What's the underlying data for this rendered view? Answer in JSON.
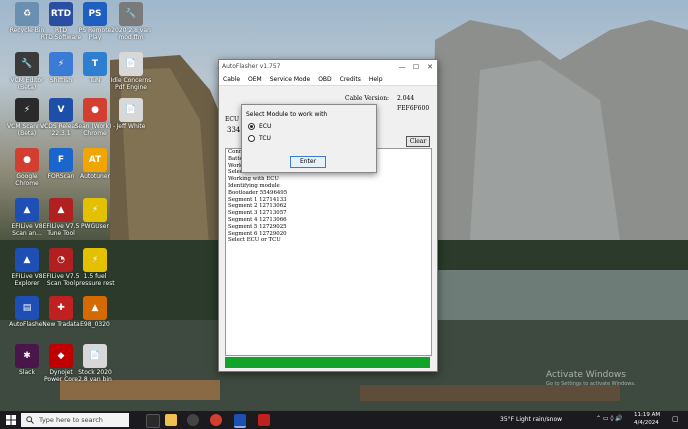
{
  "desktop": {
    "icons": [
      {
        "label": "Recycle Bin",
        "glyph": "♻",
        "color": "#6b8fb0"
      },
      {
        "label": "RTD\nRTD Software",
        "glyph": "RTD",
        "color": "#2a4fa0"
      },
      {
        "label": "PS Remote\nPlay",
        "glyph": "PS",
        "color": "#1f5fbf"
      },
      {
        "label": "2020 2.8 van\nmod ffm",
        "glyph": "🔧",
        "color": "#7a7a7a"
      },
      {
        "label": "VCM Editor\n(Beta)",
        "glyph": "🔧",
        "color": "#3a3a3a"
      },
      {
        "label": "Shiftish",
        "glyph": "⚡",
        "color": "#3a7bd5"
      },
      {
        "label": "TuN",
        "glyph": "T",
        "color": "#2f7fd0"
      },
      {
        "label": "Idle Concerns\nPdf Engine",
        "glyph": "📄",
        "color": "#d8d8d8"
      },
      {
        "label": "VCM Scanner\n(Beta)",
        "glyph": "⚡",
        "color": "#2a2a2a"
      },
      {
        "label": "VCDS Release\n22.3.1",
        "glyph": "V",
        "color": "#1e4fa8"
      },
      {
        "label": "Sean (Work) -\nChrome",
        "glyph": "●",
        "color": "#d23f31"
      },
      {
        "label": "Jeff White",
        "glyph": "📄",
        "color": "#d8d8d8"
      },
      {
        "label": "Google\nChrome",
        "glyph": "●",
        "color": "#d23f31"
      },
      {
        "label": "FORScan",
        "glyph": "F",
        "color": "#1a66cc"
      },
      {
        "label": "Autotuner",
        "glyph": "AT",
        "color": "#f0a500"
      },
      {
        "label": "EFILive V8\nScan an...",
        "glyph": "▲",
        "color": "#1d4fb5"
      },
      {
        "label": "EFILive V7.5\nTune Tool",
        "glyph": "▲",
        "color": "#b02020"
      },
      {
        "label": "PWGUser",
        "glyph": "⚡",
        "color": "#e3c100"
      },
      {
        "label": "EFILive V8\nExplorer",
        "glyph": "▲",
        "color": "#1d4fb5"
      },
      {
        "label": "EFILive V7.5\nScan Tool",
        "glyph": "◔",
        "color": "#b02020"
      },
      {
        "label": "1.5 fuel\npressure rest",
        "glyph": "⚡",
        "color": "#e3c100"
      },
      {
        "label": "AutoFlasher",
        "glyph": "▤",
        "color": "#1d4fb5"
      },
      {
        "label": "New Tradata",
        "glyph": "✚",
        "color": "#c02020"
      },
      {
        "label": "E98_0320",
        "glyph": "▲",
        "color": "#d46a00"
      },
      {
        "label": "Slack",
        "glyph": "✱",
        "color": "#4a154b"
      },
      {
        "label": "Dynojet\nPower Core",
        "glyph": "◆",
        "color": "#c00000"
      },
      {
        "label": "Stock 2020\n2.8 van bin",
        "glyph": "📄",
        "color": "#d8d8d8"
      }
    ]
  },
  "app": {
    "title": "AutoFlasher v1.757",
    "window_buttons": {
      "minimize": "—",
      "maximize": "☐",
      "close": "✕"
    },
    "menu": [
      "Cable",
      "OEM",
      "Service Mode",
      "OBD",
      "Credits",
      "Help"
    ],
    "info": {
      "cable_version_label": "Cable Version:",
      "cable_version_value": "2.044",
      "cable_id_value": "FEF6F600",
      "ecu_label_partial": "ECU S",
      "ecu_value_partial": "3341"
    },
    "clear_label": "Clear",
    "log_lines": [
      "Conne",
      "Batter",
      "Workin",
      "Select ECU or TCU",
      "Working with ECU",
      "Identifying module",
      "Bootloader 55496495",
      "Segment 1 12714133",
      "Segment 2 12713062",
      "Segment 3 12713057",
      "Segment 4 12713066",
      "Segment 5 12729025",
      "Segment 6 12729020",
      "Select ECU or TCU"
    ],
    "progress_fraction": 1.0
  },
  "dialog": {
    "title": "Select Module to work with",
    "options": [
      {
        "label": "ECU",
        "selected": true
      },
      {
        "label": "TCU",
        "selected": false
      }
    ],
    "enter_label": "Enter"
  },
  "taskbar": {
    "search_placeholder": "Type here to search",
    "weather": "35°F  Light rain/snow",
    "time": "11:19 AM",
    "date": "4/4/2024",
    "watermark_title": "Activate Windows",
    "watermark_sub": "Go to Settings to activate Windows."
  }
}
